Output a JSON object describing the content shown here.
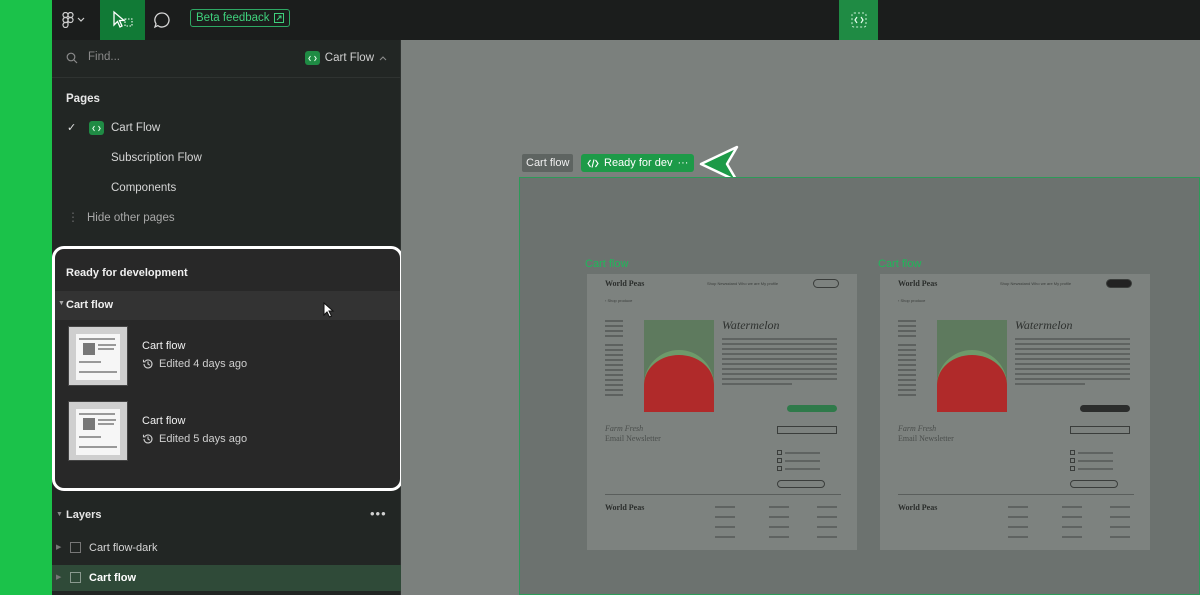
{
  "colors": {
    "accent_green": "#1bc24a",
    "dev_green": "#1d9a48",
    "sidebar_bg": "#222624",
    "canvas_bg": "#7b807d"
  },
  "toolbar": {
    "logo_icon": "figma-logo-icon",
    "move_icon": "cursor-arrow-icon",
    "comment_icon": "speech-bubble-icon",
    "beta_label": "Beta feedback",
    "devmode_icon": "code-brackets-icon"
  },
  "search": {
    "placeholder": "Find...",
    "current_page": "Cart Flow"
  },
  "pages": {
    "heading": "Pages",
    "items": [
      {
        "label": "Cart Flow",
        "selected": true
      },
      {
        "label": "Subscription Flow"
      },
      {
        "label": "Components"
      }
    ],
    "hide_other": "Hide other pages"
  },
  "ready": {
    "heading": "Ready for development",
    "group_label": "Cart flow",
    "items": [
      {
        "name": "Cart flow",
        "edited": "Edited 4 days ago"
      },
      {
        "name": "Cart flow",
        "edited": "Edited 5 days ago"
      }
    ]
  },
  "layers": {
    "heading": "Layers",
    "more": "•••",
    "items": [
      {
        "label": "Cart flow-dark"
      },
      {
        "label": "Cart flow",
        "selected": true
      }
    ]
  },
  "canvas": {
    "section_label": "Cart flow",
    "status_label": "Ready for dev",
    "status_more": "···",
    "frames": [
      {
        "label": "Cart flow",
        "theme": "light"
      },
      {
        "label": "Cart flow",
        "theme": "dark"
      }
    ],
    "mock": {
      "brand": "World Peas",
      "nav": "Shop   Newsstand   Who we are   My profile",
      "back": "‹ Shop produce",
      "product": "Watermelon",
      "newsletter_1": "Farm Fresh",
      "newsletter_2": "Email Newsletter",
      "footer_brand": "World Peas"
    }
  }
}
